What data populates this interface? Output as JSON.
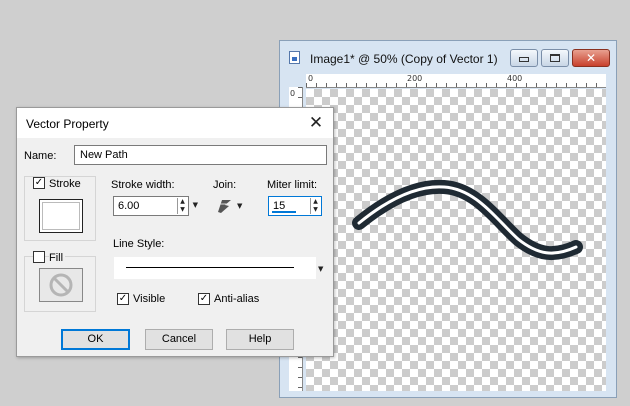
{
  "image_window": {
    "title": "Image1* @  50% (Copy of Vector 1)",
    "ruler_labels": [
      "0",
      "200",
      "400"
    ],
    "vruler_label": "0",
    "stroke_color": "#1f2a33"
  },
  "dialog": {
    "title": "Vector Property",
    "name_label": "Name:",
    "name_value": "New Path",
    "stroke": {
      "label": "Stroke",
      "checked": true
    },
    "fill": {
      "label": "Fill",
      "checked": false
    },
    "stroke_width": {
      "label": "Stroke width:",
      "value": "6.00"
    },
    "join": {
      "label": "Join:"
    },
    "miter_limit": {
      "label": "Miter limit:",
      "value": "15"
    },
    "line_style": {
      "label": "Line Style:"
    },
    "visible": {
      "label": "Visible",
      "checked": true
    },
    "anti_alias": {
      "label": "Anti-alias",
      "checked": true
    },
    "buttons": {
      "ok": "OK",
      "cancel": "Cancel",
      "help": "Help"
    }
  },
  "icons": {
    "close": "close-icon",
    "join": "join-style-icon",
    "no_fill": "no-fill-icon"
  }
}
